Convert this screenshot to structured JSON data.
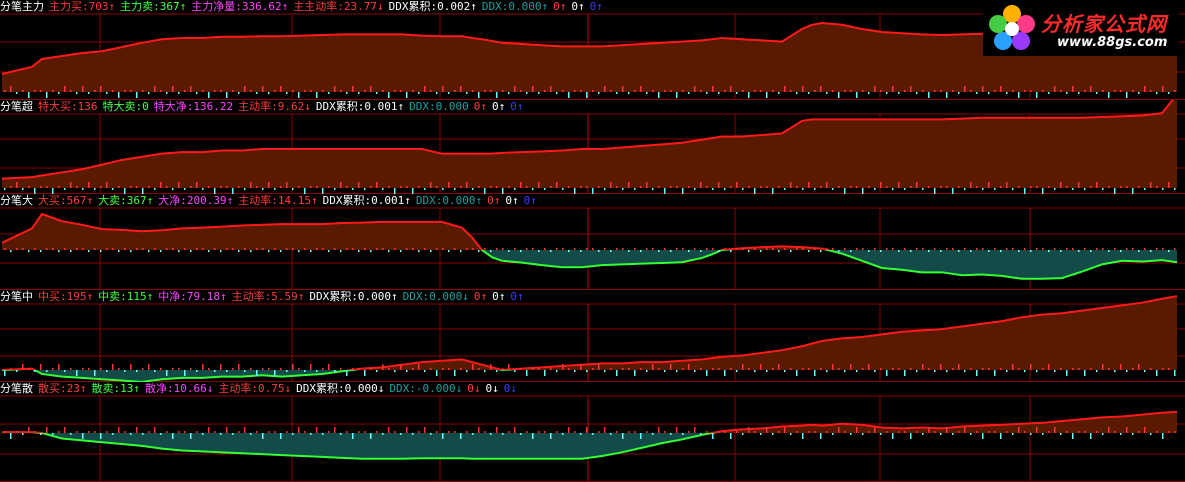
{
  "colors": {
    "background": "#000000",
    "grid": "#8a0000",
    "fill_positive": "#5a1a00",
    "fill_negative": "#124b48",
    "line_positive": "#ff1a1a",
    "line_negative": "#33ff33",
    "bar_positive": "#ff3333",
    "bar_negative": "#66ffff",
    "label_white": "#ffffff",
    "label_red": "#ff3c3c",
    "label_green": "#44ff44",
    "label_magenta": "#ff44ff",
    "label_yellow": "#ffff44",
    "label_teal": "#20a0a0",
    "label_blue": "#3b3bff"
  },
  "logo": {
    "name": "分析家公式网",
    "url": "www.88gs.com",
    "icon": "flower-icon"
  },
  "panels": [
    {
      "id": "main",
      "title": "分笔主力",
      "tokens": [
        {
          "label": "主力买:",
          "value": "703",
          "arrow": "↑",
          "color": "label_red"
        },
        {
          "label": "主力卖:",
          "value": "367",
          "arrow": "↑",
          "color": "label_green"
        },
        {
          "label": "主力净量:",
          "value": "336.62",
          "arrow": "↑",
          "color": "label_magenta"
        },
        {
          "label": "主主动率:",
          "value": "23.77",
          "arrow": "↓",
          "color": "label_red"
        },
        {
          "label": "DDX累积:",
          "value": "0.002",
          "arrow": "↑",
          "color": "label_white"
        },
        {
          "label": "DDX:",
          "value": "0.000",
          "arrow": "↑",
          "color": "label_teal"
        },
        {
          "label": "",
          "value": "0",
          "arrow": "↑",
          "color": "label_red"
        },
        {
          "label": "",
          "value": "0",
          "arrow": "↑",
          "color": "label_white"
        },
        {
          "label": "",
          "value": "0",
          "arrow": "↑",
          "color": "label_blue"
        }
      ]
    },
    {
      "id": "super",
      "title": "分笔超",
      "tokens": [
        {
          "label": "特大买:",
          "value": "136",
          "arrow": "",
          "color": "label_red"
        },
        {
          "label": "特大卖:",
          "value": "0",
          "arrow": "",
          "color": "label_green"
        },
        {
          "label": "特大净:",
          "value": "136.22",
          "arrow": "",
          "color": "label_magenta"
        },
        {
          "label": "主动率:",
          "value": "9.62",
          "arrow": "↓",
          "color": "label_red"
        },
        {
          "label": "DDX累积:",
          "value": "0.001",
          "arrow": "↑",
          "color": "label_white"
        },
        {
          "label": "DDX:",
          "value": "0.000",
          "arrow": "",
          "color": "label_teal"
        },
        {
          "label": "",
          "value": "0",
          "arrow": "↑",
          "color": "label_red"
        },
        {
          "label": "",
          "value": "0",
          "arrow": "↑",
          "color": "label_white"
        },
        {
          "label": "",
          "value": "0",
          "arrow": "↑",
          "color": "label_blue"
        }
      ]
    },
    {
      "id": "large",
      "title": "分笔大",
      "tokens": [
        {
          "label": "大买:",
          "value": "567",
          "arrow": "↑",
          "color": "label_red"
        },
        {
          "label": "大卖:",
          "value": "367",
          "arrow": "↑",
          "color": "label_green"
        },
        {
          "label": "大净:",
          "value": "200.39",
          "arrow": "↑",
          "color": "label_magenta"
        },
        {
          "label": "主动率:",
          "value": "14.15",
          "arrow": "↑",
          "color": "label_red"
        },
        {
          "label": "DDX累积:",
          "value": "0.001",
          "arrow": "↑",
          "color": "label_white"
        },
        {
          "label": "DDX:",
          "value": "0.000",
          "arrow": "↑",
          "color": "label_teal"
        },
        {
          "label": "",
          "value": "0",
          "arrow": "↑",
          "color": "label_red"
        },
        {
          "label": "",
          "value": "0",
          "arrow": "↑",
          "color": "label_white"
        },
        {
          "label": "",
          "value": "0",
          "arrow": "↑",
          "color": "label_blue"
        }
      ]
    },
    {
      "id": "medium",
      "title": "分笔中",
      "tokens": [
        {
          "label": "中买:",
          "value": "195",
          "arrow": "↑",
          "color": "label_red"
        },
        {
          "label": "中卖:",
          "value": "115",
          "arrow": "↑",
          "color": "label_green"
        },
        {
          "label": "中净:",
          "value": "79.18",
          "arrow": "↑",
          "color": "label_magenta"
        },
        {
          "label": "主动率:",
          "value": "5.59",
          "arrow": "↑",
          "color": "label_red"
        },
        {
          "label": "DDX累积:",
          "value": "0.000",
          "arrow": "↑",
          "color": "label_white"
        },
        {
          "label": "DDX:",
          "value": "0.000",
          "arrow": "↓",
          "color": "label_teal"
        },
        {
          "label": "",
          "value": "0",
          "arrow": "↑",
          "color": "label_red"
        },
        {
          "label": "",
          "value": "0",
          "arrow": "↑",
          "color": "label_white"
        },
        {
          "label": "",
          "value": "0",
          "arrow": "↑",
          "color": "label_blue"
        }
      ]
    },
    {
      "id": "retail",
      "title": "分笔散",
      "tokens": [
        {
          "label": "散买:",
          "value": "23",
          "arrow": "↑",
          "color": "label_red"
        },
        {
          "label": "散卖:",
          "value": "13",
          "arrow": "↑",
          "color": "label_green"
        },
        {
          "label": "散净:",
          "value": "10.66",
          "arrow": "↓",
          "color": "label_magenta"
        },
        {
          "label": "主动率:",
          "value": "0.75",
          "arrow": "↓",
          "color": "label_red"
        },
        {
          "label": "DDX累积:",
          "value": "0.000",
          "arrow": "↓",
          "color": "label_white"
        },
        {
          "label": "DDX:",
          "value": "-0.000",
          "arrow": "↓",
          "color": "label_teal"
        },
        {
          "label": "",
          "value": "0",
          "arrow": "↓",
          "color": "label_red"
        },
        {
          "label": "",
          "value": "0",
          "arrow": "↓",
          "color": "label_white"
        },
        {
          "label": "",
          "value": "0",
          "arrow": "↓",
          "color": "label_blue"
        }
      ]
    }
  ],
  "chart_data": {
    "type": "area",
    "x": [
      0,
      30,
      40,
      60,
      80,
      100,
      120,
      140,
      160,
      180,
      200,
      220,
      240,
      260,
      280,
      300,
      320,
      340,
      360,
      380,
      400,
      420,
      440,
      460,
      470,
      480,
      490,
      500,
      520,
      540,
      560,
      580,
      600,
      620,
      640,
      660,
      680,
      700,
      710,
      720,
      740,
      760,
      780,
      800,
      810,
      820,
      840,
      860,
      880,
      900,
      920,
      940,
      960,
      980,
      1000,
      1020,
      1040,
      1060,
      1080,
      1100,
      1120,
      1140,
      1160,
      1175
    ],
    "series": [
      {
        "name": "分笔主力",
        "values": [
          0.3,
          0.42,
          0.55,
          0.6,
          0.65,
          0.68,
          0.75,
          0.82,
          0.88,
          0.9,
          0.9,
          0.92,
          0.92,
          0.93,
          0.93,
          0.94,
          0.95,
          0.96,
          0.96,
          0.96,
          0.96,
          0.94,
          0.93,
          0.93,
          0.9,
          0.88,
          0.85,
          0.82,
          0.8,
          0.78,
          0.76,
          0.76,
          0.76,
          0.78,
          0.8,
          0.82,
          0.84,
          0.86,
          0.88,
          0.9,
          0.88,
          0.86,
          0.84,
          1.05,
          1.12,
          1.15,
          1.12,
          1.05,
          1.0,
          0.98,
          0.96,
          0.95,
          0.96,
          0.97,
          0.98,
          0.99,
          1.0,
          0.99,
          0.98,
          0.97,
          0.96,
          0.95,
          0.94,
          0.93
        ]
      },
      {
        "name": "分笔超",
        "values": [
          0.12,
          0.14,
          0.16,
          0.2,
          0.24,
          0.3,
          0.36,
          0.4,
          0.44,
          0.46,
          0.46,
          0.48,
          0.48,
          0.5,
          0.5,
          0.5,
          0.5,
          0.5,
          0.5,
          0.5,
          0.5,
          0.5,
          0.44,
          0.44,
          0.44,
          0.44,
          0.44,
          0.45,
          0.46,
          0.47,
          0.48,
          0.5,
          0.5,
          0.52,
          0.54,
          0.56,
          0.58,
          0.62,
          0.64,
          0.66,
          0.66,
          0.68,
          0.7,
          0.86,
          0.88,
          0.88,
          0.88,
          0.88,
          0.88,
          0.88,
          0.88,
          0.88,
          0.89,
          0.9,
          0.9,
          0.9,
          0.9,
          0.9,
          0.9,
          0.91,
          0.92,
          0.93,
          0.96,
          1.2
        ]
      },
      {
        "name": "分笔大",
        "values": [
          0.2,
          0.6,
          1.0,
          0.8,
          0.7,
          0.58,
          0.56,
          0.52,
          0.55,
          0.6,
          0.62,
          0.65,
          0.68,
          0.7,
          0.72,
          0.72,
          0.72,
          0.75,
          0.76,
          0.78,
          0.78,
          0.78,
          0.78,
          0.62,
          0.35,
          0.0,
          -0.2,
          -0.3,
          -0.35,
          -0.42,
          -0.48,
          -0.48,
          -0.42,
          -0.4,
          -0.38,
          -0.36,
          -0.34,
          -0.22,
          -0.12,
          0.0,
          0.05,
          0.08,
          0.1,
          0.08,
          0.06,
          0.04,
          -0.1,
          -0.3,
          -0.5,
          -0.55,
          -0.62,
          -0.62,
          -0.7,
          -0.68,
          -0.72,
          -0.8,
          -0.8,
          -0.78,
          -0.6,
          -0.4,
          -0.3,
          -0.32,
          -0.28,
          -0.34
        ]
      },
      {
        "name": "分笔中",
        "values": [
          0.0,
          0.02,
          -0.06,
          -0.1,
          -0.12,
          -0.14,
          -0.16,
          -0.18,
          -0.14,
          -0.12,
          -0.12,
          -0.1,
          -0.1,
          -0.08,
          -0.1,
          -0.08,
          -0.06,
          -0.02,
          0.02,
          0.04,
          0.08,
          0.12,
          0.14,
          0.16,
          0.12,
          0.08,
          0.04,
          0.0,
          0.02,
          0.04,
          0.06,
          0.08,
          0.1,
          0.1,
          0.12,
          0.12,
          0.14,
          0.16,
          0.18,
          0.2,
          0.22,
          0.26,
          0.3,
          0.36,
          0.4,
          0.44,
          0.48,
          0.5,
          0.54,
          0.58,
          0.6,
          0.62,
          0.66,
          0.7,
          0.74,
          0.8,
          0.84,
          0.86,
          0.9,
          0.94,
          0.98,
          1.02,
          1.08,
          1.12
        ]
      },
      {
        "name": "分笔散",
        "values": [
          0.02,
          0.02,
          0.0,
          -0.12,
          -0.16,
          -0.2,
          -0.24,
          -0.28,
          -0.34,
          -0.38,
          -0.4,
          -0.42,
          -0.44,
          -0.46,
          -0.48,
          -0.5,
          -0.52,
          -0.54,
          -0.56,
          -0.56,
          -0.56,
          -0.55,
          -0.55,
          -0.55,
          -0.56,
          -0.56,
          -0.56,
          -0.56,
          -0.56,
          -0.56,
          -0.56,
          -0.56,
          -0.5,
          -0.42,
          -0.32,
          -0.22,
          -0.14,
          -0.04,
          0.0,
          0.04,
          0.08,
          0.1,
          0.14,
          0.16,
          0.18,
          0.16,
          0.2,
          0.18,
          0.12,
          0.1,
          0.12,
          0.1,
          0.14,
          0.16,
          0.18,
          0.2,
          0.22,
          0.26,
          0.3,
          0.34,
          0.36,
          0.4,
          0.44,
          0.46
        ]
      }
    ]
  }
}
